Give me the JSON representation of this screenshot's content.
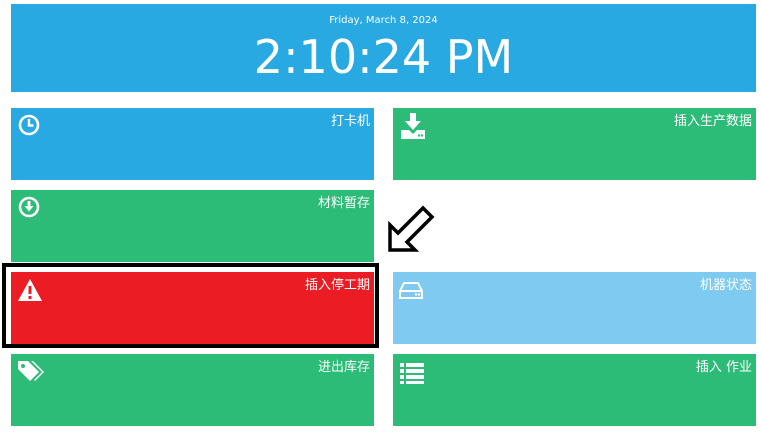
{
  "clock": {
    "date": "Friday, March 8, 2024",
    "time": "2:10:24 PM"
  },
  "tiles": [
    {
      "label": "打卡机",
      "icon": "clock-icon",
      "color": "#29a9e1"
    },
    {
      "label": "插入生产数据",
      "icon": "download-icon",
      "color": "#2dbb78"
    },
    {
      "label": "材料暂存",
      "icon": "arrow-circle-down-icon",
      "color": "#2dbb78"
    },
    {
      "label": "插入停工期",
      "icon": "warning-icon",
      "color": "#ec1c24"
    },
    {
      "label": "机器状态",
      "icon": "hard-drive-icon",
      "color": "#7ecaf0"
    },
    {
      "label": "进出库存",
      "icon": "tags-icon",
      "color": "#2dbb78"
    },
    {
      "label": "插入 作业",
      "icon": "list-icon",
      "color": "#2dbb78"
    }
  ]
}
